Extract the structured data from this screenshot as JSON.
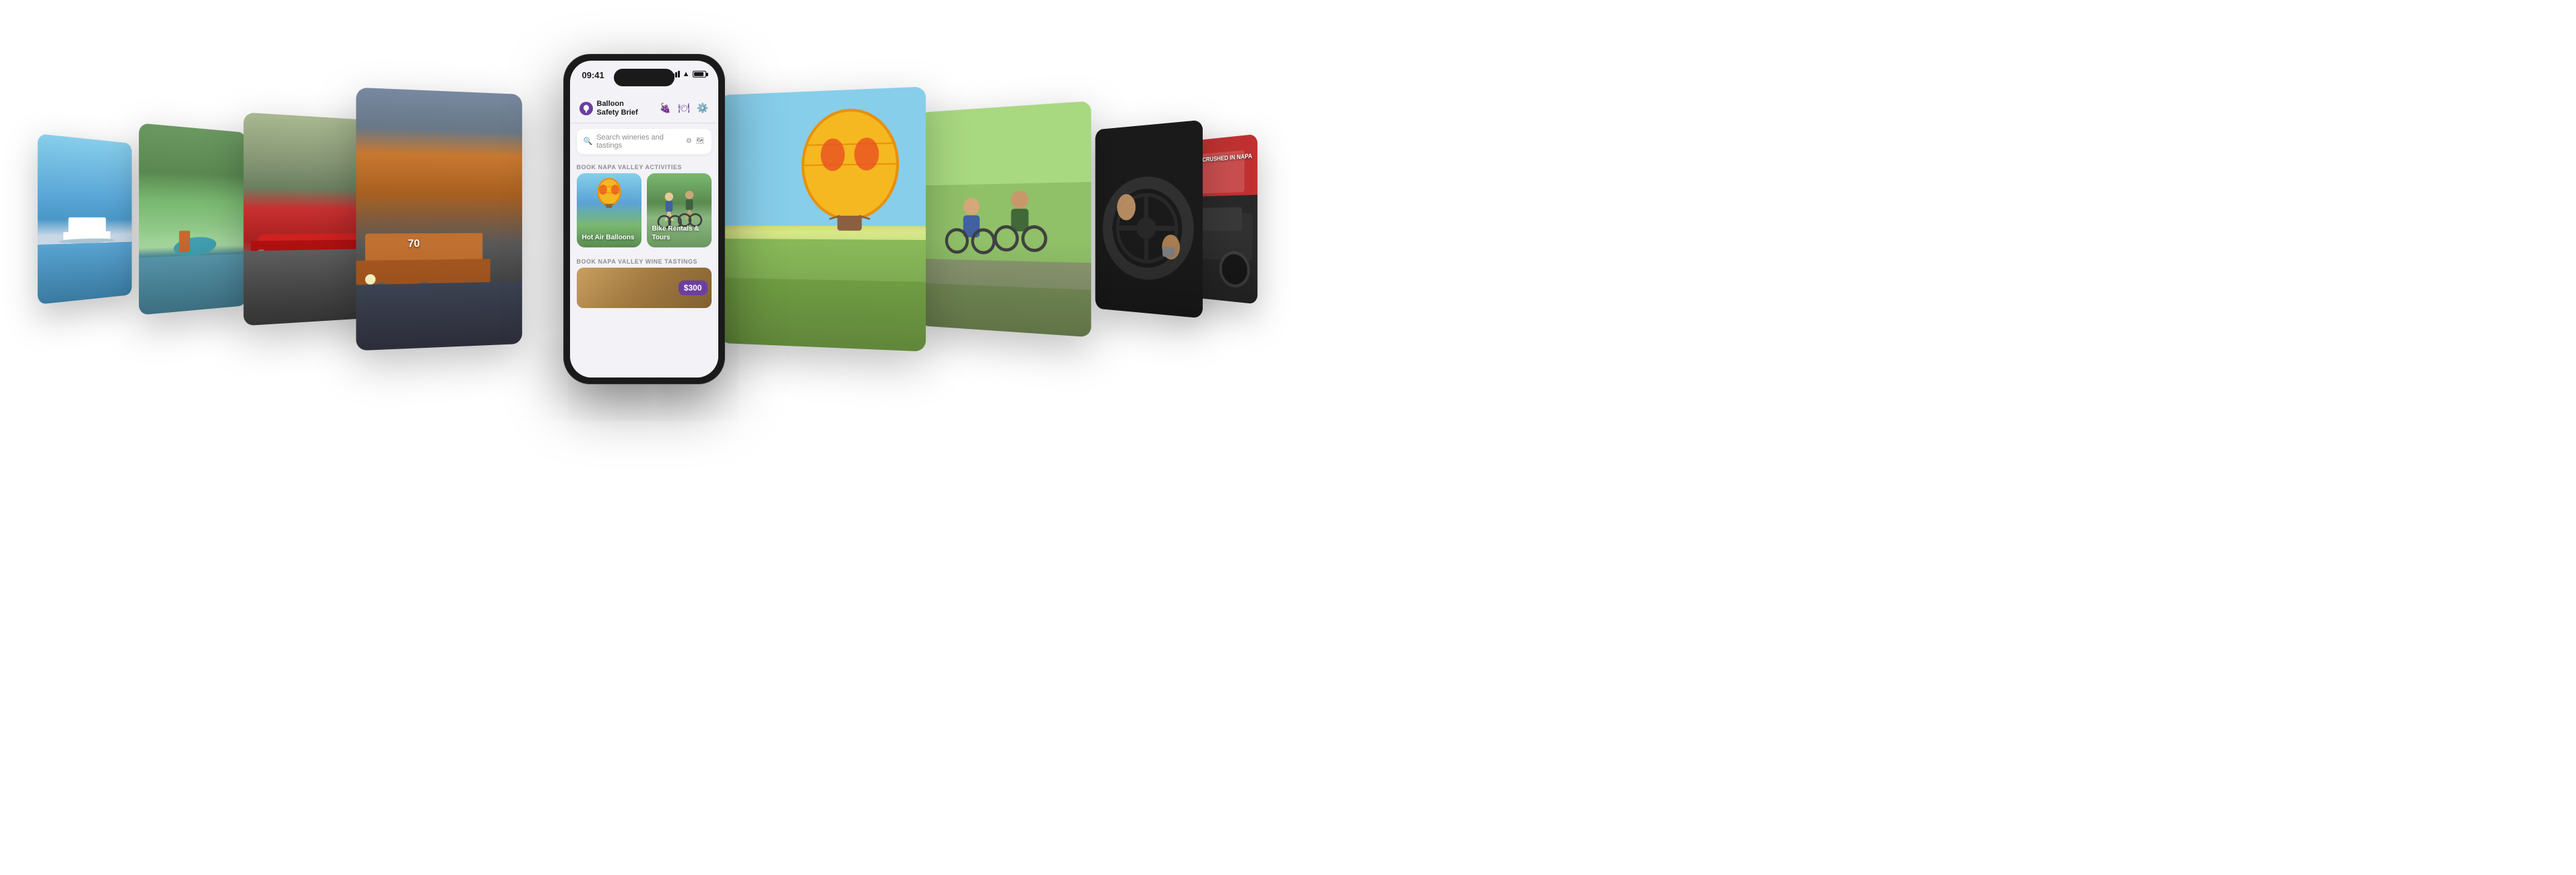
{
  "scene": {
    "background_color": "#ffffff"
  },
  "phone": {
    "status_bar": {
      "time": "09:41",
      "signal_label": "signal",
      "wifi_label": "wifi",
      "battery_label": "battery"
    },
    "header": {
      "icon_label": "balloon-icon",
      "title_line1": "Balloon",
      "title_line2": "Safety Brief",
      "icon_grapes": "🍇",
      "icon_food": "🍽",
      "icon_settings": "⚙️"
    },
    "search": {
      "placeholder": "Search wineries and tastings",
      "filter_icon": "filter",
      "map_icon": "map"
    },
    "activities_section": {
      "label": "BOOK NAPA VALLEY ACTIVITIES",
      "cards": [
        {
          "title": "Hot Air Balloons",
          "image_type": "balloon"
        },
        {
          "title": "Bike Rentals & Tours",
          "image_type": "bike"
        }
      ]
    },
    "wine_section": {
      "label": "BOOK NAPA VALLEY WINE TASTINGS",
      "cards": [
        {
          "price": "$300",
          "image_type": "winery"
        }
      ]
    }
  },
  "cards": {
    "card1": {
      "scene": "yacht",
      "alt": "Yacht on water"
    },
    "card2": {
      "scene": "kayak",
      "alt": "Person kayaking"
    },
    "card3": {
      "scene": "redcar",
      "alt": "Red Ferrari on road"
    },
    "card4": {
      "scene": "train",
      "alt": "Napa Valley Wine Train"
    },
    "card5": {
      "scene": "balloon_right",
      "alt": "Hot air balloon in sky"
    },
    "card6": {
      "scene": "biketour",
      "alt": "People cycling through vineyard"
    },
    "card7": {
      "scene": "steering",
      "alt": "Steering wheel close-up"
    },
    "card8": {
      "scene": "crusher",
      "alt": "Get Crushed in Napa vehicle",
      "overlay_text": "GET CRUSHED\nIN NAPA"
    }
  }
}
